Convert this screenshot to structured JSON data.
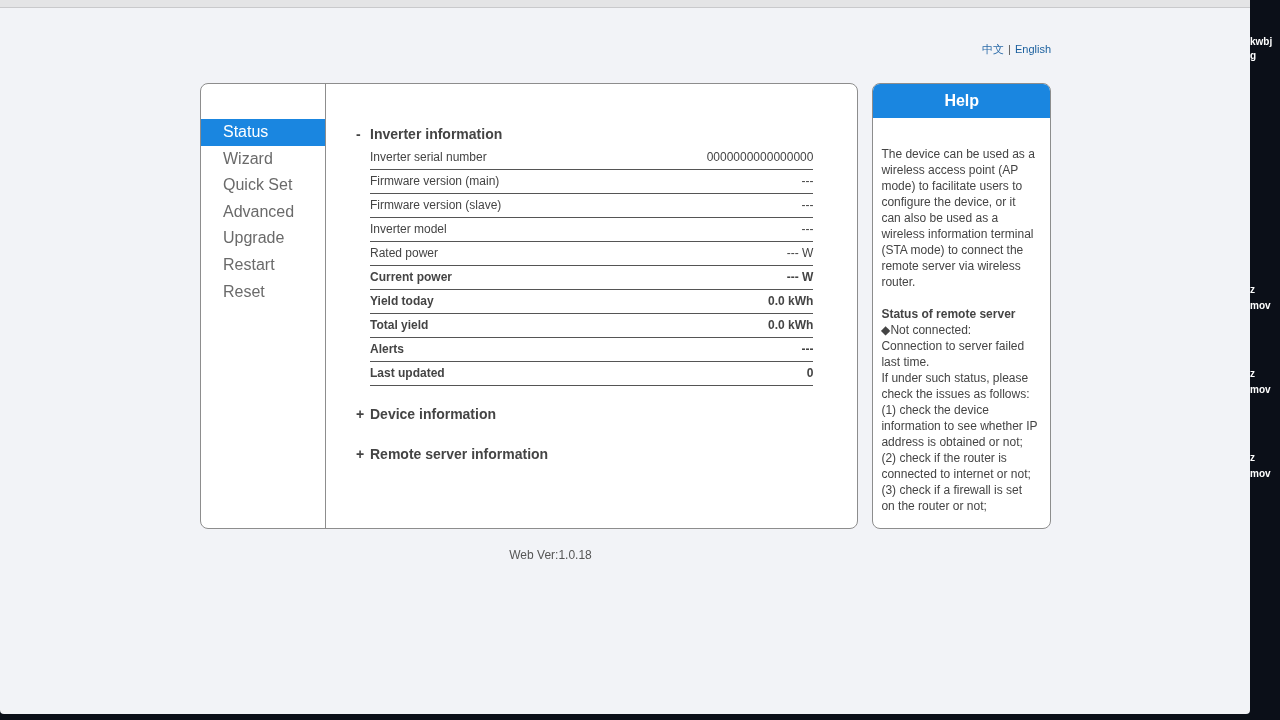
{
  "language_links": [
    {
      "label": "中文",
      "selected": false
    },
    {
      "label": "English",
      "selected": true
    }
  ],
  "language_separator": "|",
  "sidebar": {
    "items": [
      {
        "label": "Status",
        "selected": true
      },
      {
        "label": "Wizard",
        "selected": false
      },
      {
        "label": "Quick Set",
        "selected": false
      },
      {
        "label": "Advanced",
        "selected": false
      },
      {
        "label": "Upgrade",
        "selected": false
      },
      {
        "label": "Restart",
        "selected": false
      },
      {
        "label": "Reset",
        "selected": false
      }
    ]
  },
  "sections": [
    {
      "sign": "-",
      "title": "Inverter information",
      "rows": [
        {
          "label": "Inverter serial number",
          "value": "0000000000000000",
          "emphasis": false
        },
        {
          "label": "Firmware version (main)",
          "value": "---",
          "emphasis": false
        },
        {
          "label": "Firmware version (slave)",
          "value": "---",
          "emphasis": false
        },
        {
          "label": "Inverter model",
          "value": "---",
          "emphasis": false
        },
        {
          "label": "Rated power",
          "value": "--- W",
          "emphasis": false
        },
        {
          "label": "Current power",
          "value": "--- W",
          "emphasis": true
        },
        {
          "label": "Yield today",
          "value": "0.0 kWh",
          "emphasis": true
        },
        {
          "label": "Total yield",
          "value": "0.0 kWh",
          "emphasis": true
        },
        {
          "label": "Alerts",
          "value": "---",
          "emphasis": true
        },
        {
          "label": "Last updated",
          "value": "0",
          "emphasis": true
        }
      ]
    },
    {
      "sign": "+",
      "title": "Device information"
    },
    {
      "sign": "+",
      "title": "Remote server information"
    }
  ],
  "help": {
    "title": "Help",
    "blocks": [
      {
        "kind": "paragraph",
        "text": "The device can be used as a wireless access point (AP mode) to facilitate users to configure the device, or it can also be used as a wireless information terminal (STA mode) to connect the remote server via wireless router."
      },
      {
        "kind": "heading",
        "text": "Status of remote server"
      },
      {
        "kind": "line",
        "text": "◆Not connected:"
      },
      {
        "kind": "line",
        "text": "Connection to server failed last time."
      },
      {
        "kind": "line",
        "text": "If under such status, please check the issues as follows:"
      },
      {
        "kind": "line",
        "text": "(1) check the device information to see whether IP address is obtained or not;"
      },
      {
        "kind": "line",
        "text": "(2) check if the router is connected to internet or not;"
      },
      {
        "kind": "line",
        "text": "(3) check if a firewall is set on the router or not;"
      }
    ]
  },
  "footer": "Web Ver:1.0.18",
  "desktop_labels": [
    "kwbj",
    "g",
    "z",
    "mov",
    "z",
    "mov",
    "z",
    "mov"
  ]
}
